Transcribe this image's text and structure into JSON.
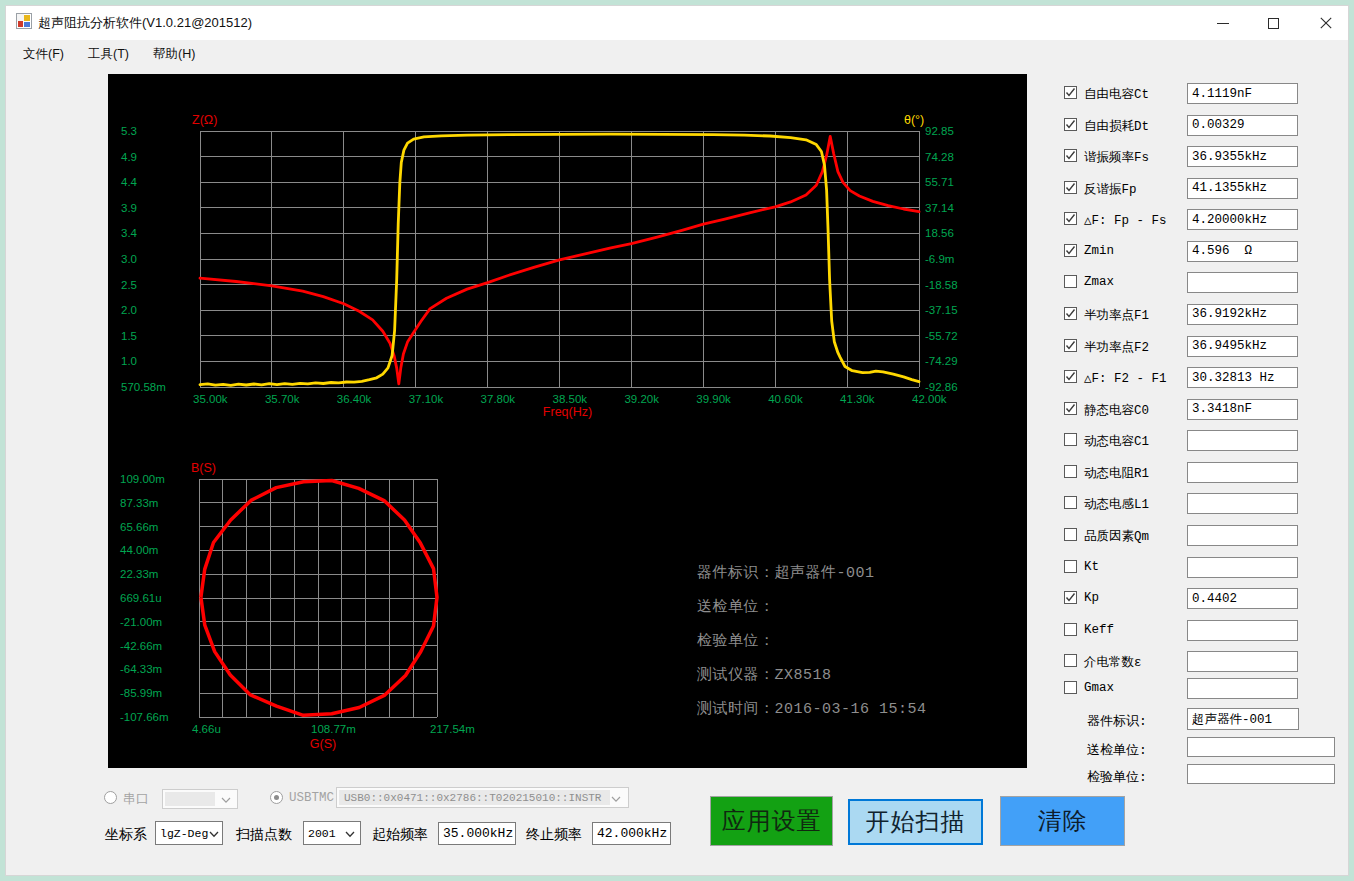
{
  "window": {
    "title": "超声阻抗分析软件(V1.0.21@201512)",
    "controls": {
      "minimize": "minimize",
      "maximize": "maximize",
      "close": "close"
    }
  },
  "menu": {
    "items": [
      "文件(F)",
      "工具(T)",
      "帮助(H)"
    ]
  },
  "chart_data": [
    {
      "type": "line",
      "title_left": "Z(Ω)",
      "title_right": "θ(°)",
      "xlabel": "Freq(Hz)",
      "x_ticks": [
        "35.00k",
        "35.70k",
        "36.40k",
        "37.10k",
        "37.80k",
        "38.50k",
        "39.20k",
        "39.90k",
        "40.60k",
        "41.30k",
        "42.00k"
      ],
      "y_left_ticks": [
        "5.3",
        "4.9",
        "4.4",
        "3.9",
        "3.4",
        "3.0",
        "2.5",
        "2.0",
        "1.5",
        "1.0",
        "570.58m"
      ],
      "y_right_ticks": [
        "92.85",
        "74.28",
        "55.71",
        "37.14",
        "18.56",
        "-6.9m",
        "-18.58",
        "-37.15",
        "-55.72",
        "-74.29",
        "-92.86"
      ],
      "x_range_khz": [
        35.0,
        42.0
      ],
      "z_axis_range": [
        0.57058,
        5.3006
      ],
      "theta_axis_range": [
        -92.86,
        92.85
      ],
      "grid": [
        10,
        10
      ],
      "colors": {
        "z": "#ff0000",
        "theta": "#ffd800",
        "grid": "#8a8a8a",
        "ticks": "#00a651"
      },
      "series": [
        {
          "name": "Z",
          "axis": "z",
          "points": [
            [
              35.0,
              2.58
            ],
            [
              35.35,
              2.52
            ],
            [
              35.7,
              2.44
            ],
            [
              36.0,
              2.34
            ],
            [
              36.2,
              2.24
            ],
            [
              36.4,
              2.11
            ],
            [
              36.55,
              1.97
            ],
            [
              36.68,
              1.81
            ],
            [
              36.78,
              1.6
            ],
            [
              36.85,
              1.38
            ],
            [
              36.89,
              1.15
            ],
            [
              36.915,
              0.92
            ],
            [
              36.935,
              0.63
            ],
            [
              36.955,
              0.92
            ],
            [
              36.98,
              1.18
            ],
            [
              37.02,
              1.4
            ],
            [
              37.08,
              1.58
            ],
            [
              37.15,
              1.78
            ],
            [
              37.24,
              2.02
            ],
            [
              37.4,
              2.21
            ],
            [
              37.6,
              2.38
            ],
            [
              37.8,
              2.5
            ],
            [
              38.0,
              2.63
            ],
            [
              38.25,
              2.78
            ],
            [
              38.5,
              2.92
            ],
            [
              38.75,
              3.03
            ],
            [
              39.0,
              3.14
            ],
            [
              39.2,
              3.22
            ],
            [
              39.45,
              3.34
            ],
            [
              39.7,
              3.47
            ],
            [
              39.9,
              3.58
            ],
            [
              40.1,
              3.67
            ],
            [
              40.35,
              3.79
            ],
            [
              40.6,
              3.9
            ],
            [
              40.75,
              3.99
            ],
            [
              40.9,
              4.12
            ],
            [
              41.0,
              4.3
            ],
            [
              41.06,
              4.55
            ],
            [
              41.1,
              4.85
            ],
            [
              41.135,
              5.2
            ],
            [
              41.17,
              4.88
            ],
            [
              41.21,
              4.55
            ],
            [
              41.26,
              4.35
            ],
            [
              41.33,
              4.2
            ],
            [
              41.42,
              4.1
            ],
            [
              41.55,
              4.0
            ],
            [
              41.7,
              3.92
            ],
            [
              41.85,
              3.86
            ],
            [
              42.0,
              3.81
            ]
          ]
        },
        {
          "name": "theta",
          "axis": "theta",
          "points": [
            [
              35.0,
              -91.2
            ],
            [
              35.075,
              -90.6
            ],
            [
              35.15,
              -91.5
            ],
            [
              35.225,
              -90.9
            ],
            [
              35.3,
              -91.6
            ],
            [
              35.375,
              -90.8
            ],
            [
              35.45,
              -91.4
            ],
            [
              35.525,
              -90.7
            ],
            [
              35.6,
              -91.3
            ],
            [
              35.675,
              -90.5
            ],
            [
              35.75,
              -91.2
            ],
            [
              35.825,
              -90.4
            ],
            [
              35.9,
              -90.9
            ],
            [
              35.975,
              -90.2
            ],
            [
              36.05,
              -90.6
            ],
            [
              36.125,
              -89.9
            ],
            [
              36.2,
              -90.3
            ],
            [
              36.275,
              -89.6
            ],
            [
              36.35,
              -89.9
            ],
            [
              36.425,
              -89.2
            ],
            [
              36.5,
              -89.4
            ],
            [
              36.575,
              -88.7
            ],
            [
              36.65,
              -87.6
            ],
            [
              36.72,
              -86.2
            ],
            [
              36.78,
              -83.5
            ],
            [
              36.83,
              -79.0
            ],
            [
              36.87,
              -70.0
            ],
            [
              36.895,
              -52.0
            ],
            [
              36.915,
              -15.0
            ],
            [
              36.93,
              25.0
            ],
            [
              36.945,
              55.0
            ],
            [
              36.96,
              70.0
            ],
            [
              36.985,
              79.0
            ],
            [
              37.02,
              84.0
            ],
            [
              37.08,
              87.0
            ],
            [
              37.18,
              88.6
            ],
            [
              37.35,
              89.4
            ],
            [
              37.6,
              89.8
            ],
            [
              38.0,
              90.2
            ],
            [
              38.5,
              90.4
            ],
            [
              39.0,
              90.5
            ],
            [
              39.5,
              90.4
            ],
            [
              40.0,
              90.2
            ],
            [
              40.3,
              89.8
            ],
            [
              40.55,
              89.2
            ],
            [
              40.75,
              88.0
            ],
            [
              40.9,
              86.5
            ],
            [
              41.0,
              83.0
            ],
            [
              41.05,
              78.0
            ],
            [
              41.08,
              68.0
            ],
            [
              41.1,
              50.0
            ],
            [
              41.115,
              20.0
            ],
            [
              41.13,
              -15.0
            ],
            [
              41.15,
              -45.0
            ],
            [
              41.175,
              -60.0
            ],
            [
              41.21,
              -68.0
            ],
            [
              41.23,
              -71.0
            ],
            [
              41.28,
              -78.0
            ],
            [
              41.35,
              -81.0
            ],
            [
              41.45,
              -82.5
            ],
            [
              41.52,
              -82.3
            ],
            [
              41.58,
              -81.3
            ],
            [
              41.65,
              -81.8
            ],
            [
              41.75,
              -83.5
            ],
            [
              41.85,
              -85.5
            ],
            [
              41.93,
              -87.5
            ],
            [
              42.0,
              -89.0
            ]
          ]
        }
      ]
    },
    {
      "type": "line",
      "title_y": "B(S)",
      "title_x": "G(S)",
      "x_ticks": [
        "4.66u",
        "108.77m",
        "217.54m"
      ],
      "y_ticks": [
        "109.00m",
        "87.33m",
        "65.66m",
        "44.00m",
        "22.33m",
        "669.61u",
        "-21.00m",
        "-42.66m",
        "-64.33m",
        "-85.99m",
        "-107.66m"
      ],
      "x_range_s": [
        4.66e-06,
        0.21754
      ],
      "y_range_s": [
        -0.10766,
        0.109
      ],
      "grid": [
        10,
        10
      ],
      "colors": {
        "curve": "#ff0000",
        "grid": "#8a8a8a",
        "ticks": "#00a651"
      },
      "circle": {
        "center_g": 0.1084,
        "center_b": 0.0013,
        "radius": 0.1072
      },
      "points": [
        [
          0.00172,
          0.0013
        ],
        [
          0.00522,
          0.02673
        ],
        [
          0.01326,
          0.05123
        ],
        [
          0.02899,
          0.07165
        ],
        [
          0.04752,
          0.08951
        ],
        [
          0.07054,
          0.10114
        ],
        [
          0.09562,
          0.10658
        ],
        [
          0.12131,
          0.10763
        ],
        [
          0.14599,
          0.10041
        ],
        [
          0.16915,
          0.08931
        ],
        [
          0.1878,
          0.07164
        ],
        [
          0.20237,
          0.05062
        ],
        [
          0.21436,
          0.02742
        ],
        [
          0.21753,
          0.0013
        ],
        [
          0.21436,
          -0.02482
        ],
        [
          0.20265,
          -0.04817
        ],
        [
          0.18879,
          -0.06991
        ],
        [
          0.16984,
          -0.0877
        ],
        [
          0.14644,
          -0.099
        ],
        [
          0.12128,
          -0.10477
        ],
        [
          0.09536,
          -0.10613
        ],
        [
          0.0708,
          -0.09783
        ],
        [
          0.04708,
          -0.08753
        ],
        [
          0.02861,
          -0.06939
        ],
        [
          0.01432,
          -0.04808
        ],
        [
          0.00529,
          -0.02411
        ],
        [
          0.00172,
          0.0013
        ]
      ]
    }
  ],
  "info_overlay": {
    "lines": [
      {
        "label": "器件标识：",
        "value": "超声器件-001"
      },
      {
        "label": "送检单位：",
        "value": ""
      },
      {
        "label": "检验单位：",
        "value": ""
      },
      {
        "label": "测试仪器：",
        "value": "ZX8518"
      },
      {
        "label": "测试时间：",
        "value": "2016-03-16 15:54"
      }
    ]
  },
  "results_panel": {
    "rows": [
      {
        "label": "自由电容Ct",
        "checked": true,
        "value": "4.1119nF"
      },
      {
        "label": "自由损耗Dt",
        "checked": true,
        "value": "0.00329"
      },
      {
        "label": "谐振频率Fs",
        "checked": true,
        "value": "36.9355kHz"
      },
      {
        "label": "反谐振Fp",
        "checked": true,
        "value": "41.1355kHz"
      },
      {
        "label": "△F: Fp - Fs",
        "checked": true,
        "value": "4.20000kHz"
      },
      {
        "label": "Zmin",
        "checked": true,
        "value": "4.596  Ω"
      },
      {
        "label": "Zmax",
        "checked": false,
        "value": ""
      },
      {
        "label": "半功率点F1",
        "checked": true,
        "value": "36.9192kHz"
      },
      {
        "label": "半功率点F2",
        "checked": true,
        "value": "36.9495kHz"
      },
      {
        "label": "△F: F2 - F1",
        "checked": true,
        "value": "30.32813 Hz"
      },
      {
        "label": "静态电容C0",
        "checked": true,
        "value": "3.3418nF"
      },
      {
        "label": "动态电容C1",
        "checked": false,
        "value": ""
      },
      {
        "label": "动态电阻R1",
        "checked": false,
        "value": ""
      },
      {
        "label": "动态电感L1",
        "checked": false,
        "value": ""
      },
      {
        "label": "品质因素Qm",
        "checked": false,
        "value": ""
      },
      {
        "label": "Kt",
        "checked": false,
        "value": ""
      },
      {
        "label": "Kp",
        "checked": true,
        "value": "0.4402"
      },
      {
        "label": "Keff",
        "checked": false,
        "value": ""
      },
      {
        "label": "介电常数ε",
        "checked": false,
        "value": ""
      },
      {
        "label": "Gmax",
        "checked": false,
        "value": ""
      }
    ]
  },
  "id_fields": [
    {
      "label": "器件标识:",
      "value": "超声器件-001",
      "wide": false
    },
    {
      "label": "送检单位:",
      "value": "",
      "wide": true
    },
    {
      "label": "检验单位:",
      "value": "",
      "wide": true
    }
  ],
  "connection": {
    "serial_label": "串口",
    "serial_selected": false,
    "serial_combo_value": "",
    "usbtmc_label": "USBTMC",
    "usbtmc_selected": true,
    "usbtmc_combo_value": "USB0::0x0471::0x2786::T020215010::INSTR"
  },
  "sweep": {
    "coord_label": "坐标系",
    "coord_value": "lgZ-Deg",
    "points_label": "扫描点数",
    "points_value": "2001",
    "start_label": "起始频率",
    "start_value": "35.000kHz",
    "stop_label": "终止频率",
    "stop_value": "42.000kHz"
  },
  "buttons": {
    "apply": "应用设置",
    "scan": "开始扫描",
    "clear": "清除"
  },
  "icons": {
    "app": "app-icon",
    "minimize": "minimize-icon",
    "maximize": "maximize-icon",
    "close": "close-icon",
    "combo_arrow": "chevron-down-icon",
    "checkbox_check": "check-icon"
  }
}
